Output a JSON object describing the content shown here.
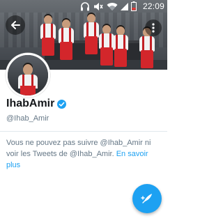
{
  "status_bar": {
    "time": "22:09",
    "icons": [
      "headset-icon",
      "mute-icon",
      "wifi-icon",
      "signal-icon",
      "battery-icon"
    ]
  },
  "banner": {
    "description_icons": [
      "back-arrow-icon",
      "overflow-menu-icon"
    ]
  },
  "profile": {
    "display_name": "IhabAmir",
    "verified": true,
    "handle": "@Ihab_Amir"
  },
  "notice": {
    "text": "Vous ne pouvez pas suivre @Ihab_Amir ni voir les Tweets de @Ihab_Amir.",
    "link_label": "En savoir plus"
  },
  "fab": {
    "icon": "compose-tweet-icon"
  },
  "colors": {
    "accent": "#1da1f2",
    "name_text": "#14171a",
    "muted_text": "#657786",
    "divider": "#e1e8ed"
  }
}
